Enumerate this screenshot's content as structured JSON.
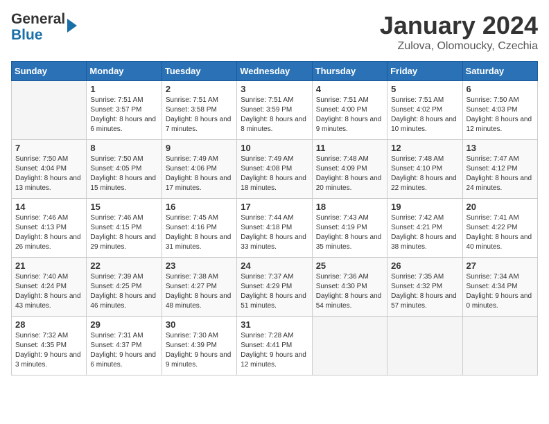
{
  "header": {
    "logo_line1": "General",
    "logo_line2": "Blue",
    "month_title": "January 2024",
    "location": "Zulova, Olomoucky, Czechia"
  },
  "days_of_week": [
    "Sunday",
    "Monday",
    "Tuesday",
    "Wednesday",
    "Thursday",
    "Friday",
    "Saturday"
  ],
  "weeks": [
    [
      {
        "num": "",
        "empty": true
      },
      {
        "num": "1",
        "sunrise": "7:51 AM",
        "sunset": "3:57 PM",
        "daylight": "8 hours and 6 minutes."
      },
      {
        "num": "2",
        "sunrise": "7:51 AM",
        "sunset": "3:58 PM",
        "daylight": "8 hours and 7 minutes."
      },
      {
        "num": "3",
        "sunrise": "7:51 AM",
        "sunset": "3:59 PM",
        "daylight": "8 hours and 8 minutes."
      },
      {
        "num": "4",
        "sunrise": "7:51 AM",
        "sunset": "4:00 PM",
        "daylight": "8 hours and 9 minutes."
      },
      {
        "num": "5",
        "sunrise": "7:51 AM",
        "sunset": "4:02 PM",
        "daylight": "8 hours and 10 minutes."
      },
      {
        "num": "6",
        "sunrise": "7:50 AM",
        "sunset": "4:03 PM",
        "daylight": "8 hours and 12 minutes."
      }
    ],
    [
      {
        "num": "7",
        "sunrise": "7:50 AM",
        "sunset": "4:04 PM",
        "daylight": "8 hours and 13 minutes."
      },
      {
        "num": "8",
        "sunrise": "7:50 AM",
        "sunset": "4:05 PM",
        "daylight": "8 hours and 15 minutes."
      },
      {
        "num": "9",
        "sunrise": "7:49 AM",
        "sunset": "4:06 PM",
        "daylight": "8 hours and 17 minutes."
      },
      {
        "num": "10",
        "sunrise": "7:49 AM",
        "sunset": "4:08 PM",
        "daylight": "8 hours and 18 minutes."
      },
      {
        "num": "11",
        "sunrise": "7:48 AM",
        "sunset": "4:09 PM",
        "daylight": "8 hours and 20 minutes."
      },
      {
        "num": "12",
        "sunrise": "7:48 AM",
        "sunset": "4:10 PM",
        "daylight": "8 hours and 22 minutes."
      },
      {
        "num": "13",
        "sunrise": "7:47 AM",
        "sunset": "4:12 PM",
        "daylight": "8 hours and 24 minutes."
      }
    ],
    [
      {
        "num": "14",
        "sunrise": "7:46 AM",
        "sunset": "4:13 PM",
        "daylight": "8 hours and 26 minutes."
      },
      {
        "num": "15",
        "sunrise": "7:46 AM",
        "sunset": "4:15 PM",
        "daylight": "8 hours and 29 minutes."
      },
      {
        "num": "16",
        "sunrise": "7:45 AM",
        "sunset": "4:16 PM",
        "daylight": "8 hours and 31 minutes."
      },
      {
        "num": "17",
        "sunrise": "7:44 AM",
        "sunset": "4:18 PM",
        "daylight": "8 hours and 33 minutes."
      },
      {
        "num": "18",
        "sunrise": "7:43 AM",
        "sunset": "4:19 PM",
        "daylight": "8 hours and 35 minutes."
      },
      {
        "num": "19",
        "sunrise": "7:42 AM",
        "sunset": "4:21 PM",
        "daylight": "8 hours and 38 minutes."
      },
      {
        "num": "20",
        "sunrise": "7:41 AM",
        "sunset": "4:22 PM",
        "daylight": "8 hours and 40 minutes."
      }
    ],
    [
      {
        "num": "21",
        "sunrise": "7:40 AM",
        "sunset": "4:24 PM",
        "daylight": "8 hours and 43 minutes."
      },
      {
        "num": "22",
        "sunrise": "7:39 AM",
        "sunset": "4:25 PM",
        "daylight": "8 hours and 46 minutes."
      },
      {
        "num": "23",
        "sunrise": "7:38 AM",
        "sunset": "4:27 PM",
        "daylight": "8 hours and 48 minutes."
      },
      {
        "num": "24",
        "sunrise": "7:37 AM",
        "sunset": "4:29 PM",
        "daylight": "8 hours and 51 minutes."
      },
      {
        "num": "25",
        "sunrise": "7:36 AM",
        "sunset": "4:30 PM",
        "daylight": "8 hours and 54 minutes."
      },
      {
        "num": "26",
        "sunrise": "7:35 AM",
        "sunset": "4:32 PM",
        "daylight": "8 hours and 57 minutes."
      },
      {
        "num": "27",
        "sunrise": "7:34 AM",
        "sunset": "4:34 PM",
        "daylight": "9 hours and 0 minutes."
      }
    ],
    [
      {
        "num": "28",
        "sunrise": "7:32 AM",
        "sunset": "4:35 PM",
        "daylight": "9 hours and 3 minutes."
      },
      {
        "num": "29",
        "sunrise": "7:31 AM",
        "sunset": "4:37 PM",
        "daylight": "9 hours and 6 minutes."
      },
      {
        "num": "30",
        "sunrise": "7:30 AM",
        "sunset": "4:39 PM",
        "daylight": "9 hours and 9 minutes."
      },
      {
        "num": "31",
        "sunrise": "7:28 AM",
        "sunset": "4:41 PM",
        "daylight": "9 hours and 12 minutes."
      },
      {
        "num": "",
        "empty": true
      },
      {
        "num": "",
        "empty": true
      },
      {
        "num": "",
        "empty": true
      }
    ]
  ]
}
